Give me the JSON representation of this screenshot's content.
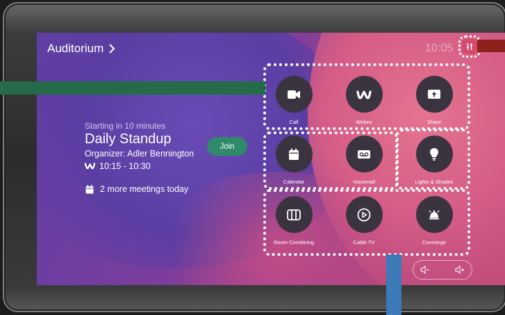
{
  "header": {
    "room_name": "Auditorium",
    "clock": "10:05"
  },
  "meeting": {
    "starting_label": "Starting in 10 minutes",
    "title": "Daily Standup",
    "organizer": "Organizer: Adler Bennington",
    "time_range": "10:15 - 10:30",
    "join_label": "Join",
    "more_meetings": "2 more meetings today"
  },
  "tiles": [
    {
      "label": "Call",
      "icon": "video-camera-icon"
    },
    {
      "label": "Webex",
      "icon": "webex-icon"
    },
    {
      "label": "Share",
      "icon": "share-screen-icon"
    },
    {
      "label": "Calendar",
      "icon": "calendar-icon"
    },
    {
      "label": "Voicemail",
      "icon": "voicemail-icon"
    },
    {
      "label": "Lights & Shades",
      "icon": "lightbulb-icon"
    },
    {
      "label": "Room Combining",
      "icon": "room-combining-icon"
    },
    {
      "label": "Cable TV",
      "icon": "play-icon"
    },
    {
      "label": "Concierge",
      "icon": "concierge-bell-icon"
    }
  ],
  "volume": {
    "down_icon": "volume-down-icon",
    "up_icon": "volume-up-icon"
  },
  "colors": {
    "settings_accent": "#d44a6a",
    "join_green": "#2e8a6a",
    "tile_circle": "#3a3340",
    "overlay_green": "#256b48",
    "overlay_red": "#8b231c",
    "overlay_blue": "#3c7ab8"
  }
}
